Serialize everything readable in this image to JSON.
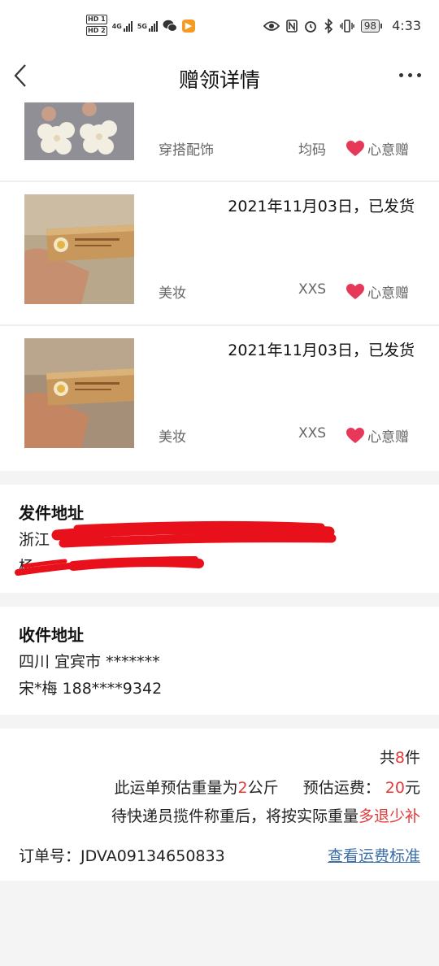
{
  "status_bar": {
    "sim1": "HD 1",
    "sim2": "HD 2",
    "net1": "4G",
    "net2": "5G",
    "battery": "98",
    "time": "4:33"
  },
  "header": {
    "title": "赠领详情",
    "back_icon": "chevron-left-icon",
    "more_icon": "more-dots-icon"
  },
  "items": [
    {
      "category": "穿搭配饰",
      "size": "均码",
      "tag": "心意赠"
    },
    {
      "date_status": "2021年11月03日，已发货",
      "category": "美妆",
      "size": "XXS",
      "tag": "心意赠"
    },
    {
      "date_status": "2021年11月03日，已发货",
      "category": "美妆",
      "size": "XXS",
      "tag": "心意赠"
    }
  ],
  "sender": {
    "title": "发件地址",
    "line1": "浙江",
    "line2": "杨"
  },
  "receiver": {
    "title": "收件地址",
    "line1": "四川 宜宾市 *******",
    "line2": "宋*梅 188****9342"
  },
  "summary": {
    "total_prefix": "共",
    "total_count": "8",
    "total_suffix": "件",
    "weight_prefix": "此运单预估重量为",
    "weight_value": "2",
    "weight_unit": "公斤",
    "fee_label": "预估运费：",
    "fee_value": "20",
    "fee_unit": "元",
    "note_prefix": "待快递员揽件称重后，将按实际重量",
    "note_highlight": "多退少补",
    "order_label": "订单号：",
    "order_no": "JDVA09134650833",
    "fee_standard_link": "查看运费标准"
  },
  "colors": {
    "accent_red": "#e33b3b",
    "link_blue": "#3c6ea8",
    "heart": "#e8385a"
  }
}
